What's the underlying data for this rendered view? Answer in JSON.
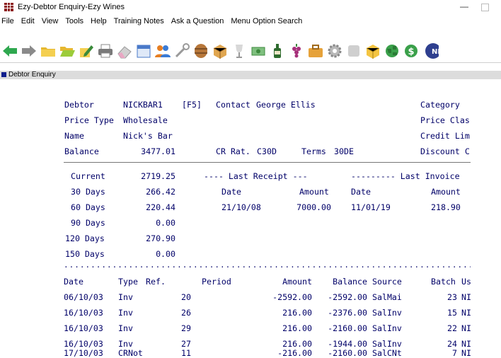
{
  "window": {
    "title": "Ezy-Debtor Enquiry-Ezy Wines",
    "minimize_glyph": "—"
  },
  "menu": [
    "File",
    "Edit",
    "View",
    "Tools",
    "Help",
    "Training Notes",
    "Ask a Question",
    "Menu Option Search"
  ],
  "toolbar": {
    "icons": [
      "back-arrow-icon",
      "forward-arrow-icon",
      "folder-icon",
      "open-folder-icon",
      "edit-icon",
      "printer-icon",
      "eraser-icon",
      "calendar-icon",
      "users-icon",
      "wrench-icon",
      "wine-barrel-icon",
      "package-icon",
      "wine-glass-icon",
      "cash-icon",
      "bottle-icon",
      "grapes-icon",
      "briefcase-icon",
      "gear-icon",
      "stop-icon",
      "box-icon",
      "globe-icon",
      "dollar-icon",
      "next-icon"
    ],
    "overflow_label": "NE"
  },
  "doc_tab": {
    "label": "Debtor Enquiry"
  },
  "header": {
    "debtor_label": "Debtor",
    "debtor_code": "NICKBAR1",
    "debtor_key": "[F5]",
    "contact_label": "Contact",
    "contact_name": "George Ellis",
    "category_label": "Category",
    "price_type_label": "Price Type",
    "price_type_value": "Wholesale",
    "price_class_label": "Price Clas",
    "name_label": "Name",
    "name_value": "Nick's Bar",
    "credit_limit_label": "Credit Lim",
    "balance_label": "Balance",
    "balance_value": "3477.01",
    "cr_rating_label": "CR Rat.",
    "cr_rating_value": "C30D",
    "terms_label": "Terms",
    "terms_value": "30DE",
    "discount_label": "Discount C"
  },
  "aging": [
    {
      "label": "Current",
      "amount": "2719.25"
    },
    {
      "label": "30 Days",
      "amount": "266.42"
    },
    {
      "label": "60 Days",
      "amount": "220.44"
    },
    {
      "label": "90 Days",
      "amount": "0.00"
    },
    {
      "label": "120 Days",
      "amount": "270.90"
    },
    {
      "label": "150 Days",
      "amount": "0.00"
    }
  ],
  "last_receipt": {
    "heading": "---- Last Receipt ---",
    "date_label": "Date",
    "amount_label": "Amount",
    "date": "21/10/08",
    "amount": "7000.00"
  },
  "last_invoice": {
    "heading": "--------- Last Invoice",
    "date_label": "Date",
    "amount_label": "Amount",
    "date": "11/01/19",
    "amount": "218.90"
  },
  "transactions": {
    "dots": "..........................................................................................................",
    "columns": {
      "date": "Date",
      "type": "Type",
      "ref": "Ref.",
      "period": "Period",
      "amount": "Amount",
      "balance": "Balance",
      "source": "Source",
      "batch": "Batch",
      "user": "Us"
    },
    "rows": [
      {
        "date": "06/10/03",
        "type": "Inv",
        "ref": "20",
        "amount": "-2592.00",
        "balance": "-2592.00",
        "source": "SalMai",
        "batch": "23",
        "user": "NI"
      },
      {
        "date": "16/10/03",
        "type": "Inv",
        "ref": "26",
        "amount": "216.00",
        "balance": "-2376.00",
        "source": "SalInv",
        "batch": "15",
        "user": "NI"
      },
      {
        "date": "16/10/03",
        "type": "Inv",
        "ref": "29",
        "amount": "216.00",
        "balance": "-2160.00",
        "source": "SalInv",
        "batch": "22",
        "user": "NI"
      },
      {
        "date": "16/10/03",
        "type": "Inv",
        "ref": "27",
        "amount": "216.00",
        "balance": "-1944.00",
        "source": "SalInv",
        "batch": "24",
        "user": "NI"
      },
      {
        "date": "17/10/03",
        "type": "CRNot",
        "ref": "11",
        "amount": "-216.00",
        "balance": "-2160.00",
        "source": "SalCNt",
        "batch": "7",
        "user": "NI"
      }
    ]
  }
}
